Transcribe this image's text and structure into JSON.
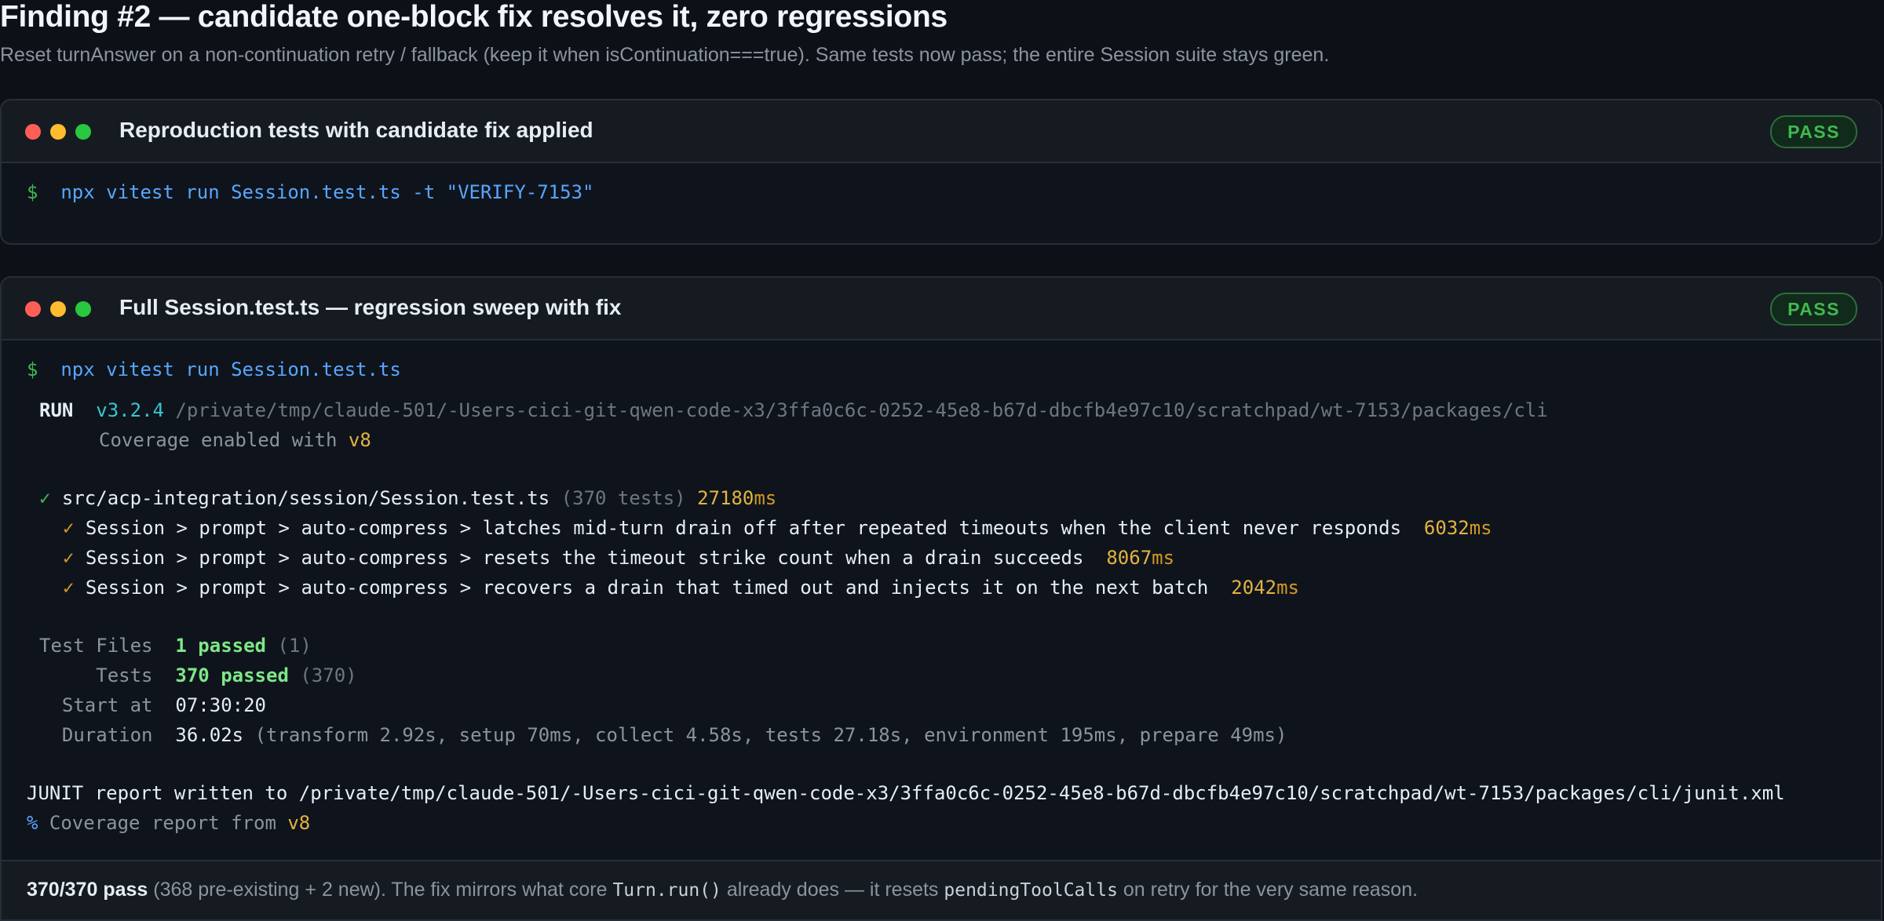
{
  "header": {
    "title": "Finding #2 — candidate one-block fix resolves it, zero regressions",
    "subtitle": "Reset turnAnswer on a non-continuation retry / fallback (keep it when isContinuation===true). Same tests now pass; the entire Session suite stays green."
  },
  "panel1": {
    "title": "Reproduction tests with candidate fix applied",
    "badge": "PASS",
    "prompt": "$",
    "command": "npx vitest run Session.test.ts -t \"VERIFY-7153\""
  },
  "panel2": {
    "title": "Full Session.test.ts — regression sweep with fix",
    "badge": "PASS",
    "prompt": "$",
    "command": "npx vitest run Session.test.ts",
    "run": {
      "label": "RUN",
      "version": "v3.2.4",
      "path": "/private/tmp/claude-501/-Users-cici-git-qwen-code-x3/3ffa0c6c-0252-45e8-b67d-dbcfb4e97c10/scratchpad/wt-7153/packages/cli",
      "coverage_text": "Coverage enabled with",
      "coverage_tool": "v8"
    },
    "file_result": {
      "check": "✓",
      "file": "src/acp-integration/session/Session.test.ts",
      "count": "(370 tests)",
      "time": "27180",
      "unit": "ms"
    },
    "tests": [
      {
        "check": "✓",
        "name": "Session > prompt > auto-compress > latches mid-turn drain off after repeated timeouts when the client never responds",
        "time": "6032",
        "unit": "ms"
      },
      {
        "check": "✓",
        "name": "Session > prompt > auto-compress > resets the timeout strike count when a drain succeeds",
        "time": "8067",
        "unit": "ms"
      },
      {
        "check": "✓",
        "name": "Session > prompt > auto-compress > recovers a drain that timed out and injects it on the next batch",
        "time": "2042",
        "unit": "ms"
      }
    ],
    "summary": {
      "files_label": "Test Files",
      "files_passed": "1 passed",
      "files_total": "(1)",
      "tests_label": "Tests",
      "tests_passed": "370 passed",
      "tests_total": "(370)",
      "start_label": "Start at",
      "start_value": "07:30:20",
      "duration_label": "Duration",
      "duration_value": "36.02s",
      "duration_detail": "(transform 2.92s, setup 70ms, collect 4.58s, tests 27.18s, environment 195ms, prepare 49ms)"
    },
    "junit": "JUNIT report written to /private/tmp/claude-501/-Users-cici-git-qwen-code-x3/3ffa0c6c-0252-45e8-b67d-dbcfb4e97c10/scratchpad/wt-7153/packages/cli/junit.xml",
    "coverage_report": {
      "symbol": "%",
      "text": "Coverage report from",
      "tool": "v8"
    },
    "footer": {
      "strong": "370/370 pass",
      "part1": " (368 pre-existing + 2 new). The fix mirrors what core ",
      "code1": "Turn.run()",
      "part2": " already does — it resets ",
      "code2": "pendingToolCalls",
      "part3": " on retry for the very same reason."
    }
  }
}
